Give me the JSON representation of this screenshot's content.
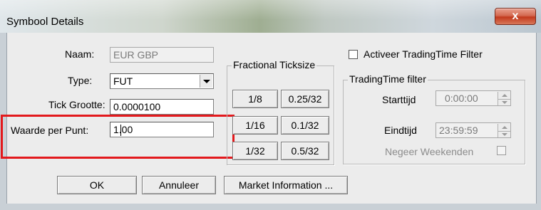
{
  "window": {
    "title": "Symbool Details",
    "close_label": "x"
  },
  "form": {
    "naam_label": "Naam:",
    "naam_value": "EUR GBP",
    "type_label": "Type:",
    "type_value": "FUT",
    "tick_label": "Tick Grootte:",
    "tick_value": "0.0000100",
    "waarde_label": "Waarde per Punt:",
    "waarde_value": "1.00"
  },
  "fractional": {
    "title": "Fractional Ticksize",
    "buttons": [
      "1/8",
      "0.25/32",
      "1/16",
      "0.1/32",
      "1/32",
      "0.5/32"
    ]
  },
  "tradingtime": {
    "checkbox_label": "Activeer TradingTime Filter",
    "checkbox_checked": false,
    "group_title": "TradingTime filter",
    "start_label": "Starttijd",
    "start_value": "0:00:00",
    "end_label": "Eindtijd",
    "end_value": "23:59:59",
    "weekend_label": "Negeer Weekenden",
    "weekend_checked": false
  },
  "buttons": {
    "ok": "OK",
    "cancel": "Annuleer",
    "market": "Market Information ..."
  },
  "colors": {
    "highlight": "#e3191c",
    "close": "#c23a1d"
  }
}
